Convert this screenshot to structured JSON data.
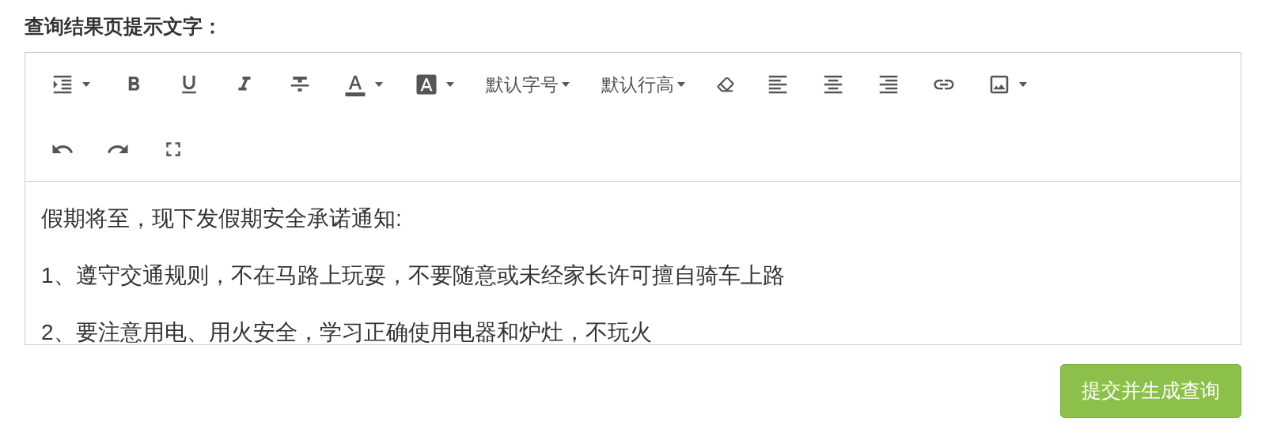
{
  "field_label": "查询结果页提示文字：",
  "toolbar": {
    "rows": [
      {
        "tools": [
          {
            "kind": "icon",
            "dropdown": true
          },
          {
            "kind": "icon",
            "dropdown": false
          },
          {
            "kind": "icon",
            "dropdown": false
          },
          {
            "kind": "icon",
            "dropdown": false
          },
          {
            "kind": "icon",
            "dropdown": false
          },
          {
            "kind": "icon",
            "dropdown": true
          },
          {
            "kind": "icon",
            "dropdown": true
          },
          {
            "kind": "select",
            "label": "默认字号"
          },
          {
            "kind": "select",
            "label": "默认行高"
          },
          {
            "kind": "icon",
            "dropdown": false
          },
          {
            "kind": "icon",
            "dropdown": false
          },
          {
            "kind": "icon",
            "dropdown": false
          },
          {
            "kind": "icon",
            "dropdown": false
          },
          {
            "kind": "icon",
            "dropdown": false
          },
          {
            "kind": "icon",
            "dropdown": true
          }
        ]
      },
      {
        "tools": [
          {
            "kind": "icon",
            "dropdown": false
          },
          {
            "kind": "icon",
            "dropdown": false
          },
          {
            "kind": "icon",
            "dropdown": false
          }
        ]
      }
    ]
  },
  "content": [
    "假期将至，现下发假期安全承诺通知:",
    "1、遵守交通规则，不在马路上玩耍，不要随意或未经家长许可擅自骑车上路",
    "2、要注意用电、用火安全，学习正确使用电器和炉灶，不玩火"
  ],
  "submit_button": "提交并生成查询"
}
